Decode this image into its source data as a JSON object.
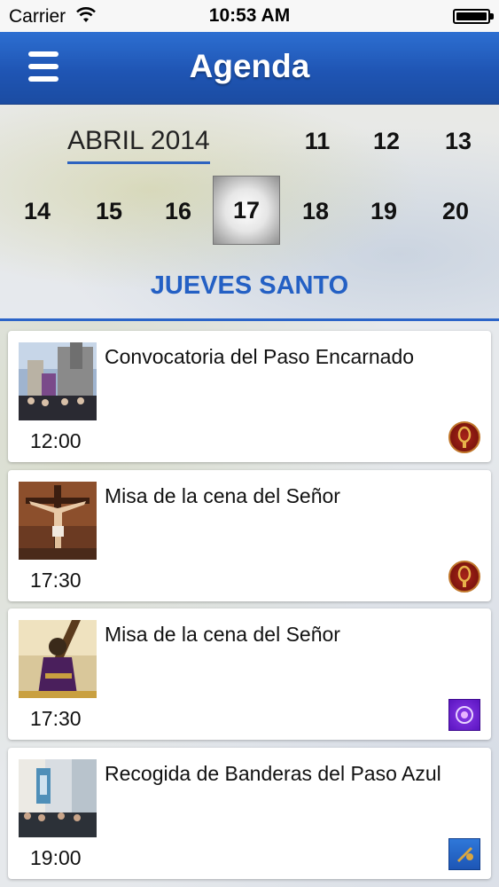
{
  "status_bar": {
    "carrier": "Carrier",
    "time": "10:53 AM"
  },
  "nav": {
    "title": "Agenda",
    "menu_icon": "hamburger-menu-icon"
  },
  "calendar": {
    "month": "ABRIL 2014",
    "days_row1": [
      "11",
      "12",
      "13"
    ],
    "days_row2": [
      "14",
      "15",
      "16",
      "17",
      "18",
      "19",
      "20"
    ],
    "selected_day": "17",
    "day_title": "JUEVES SANTO"
  },
  "events": [
    {
      "title": "Convocatoria del Paso Encarnado",
      "time": "12:00",
      "badge": "paso-encarnado-emblem"
    },
    {
      "title": "Misa de la cena del Señor",
      "time": "17:30",
      "badge": "paso-encarnado-emblem"
    },
    {
      "title": "Misa de la cena del Señor",
      "time": "17:30",
      "badge": "paso-morado-emblem"
    },
    {
      "title": "Recogida de Banderas del Paso Azul",
      "time": "19:00",
      "badge": "paso-azul-emblem"
    }
  ],
  "colors": {
    "nav_blue": "#1f55b4",
    "accent_blue": "#2460c4",
    "encarnado": "#7e150e",
    "morado": "#5a14c0",
    "azul": "#1d56b5"
  }
}
